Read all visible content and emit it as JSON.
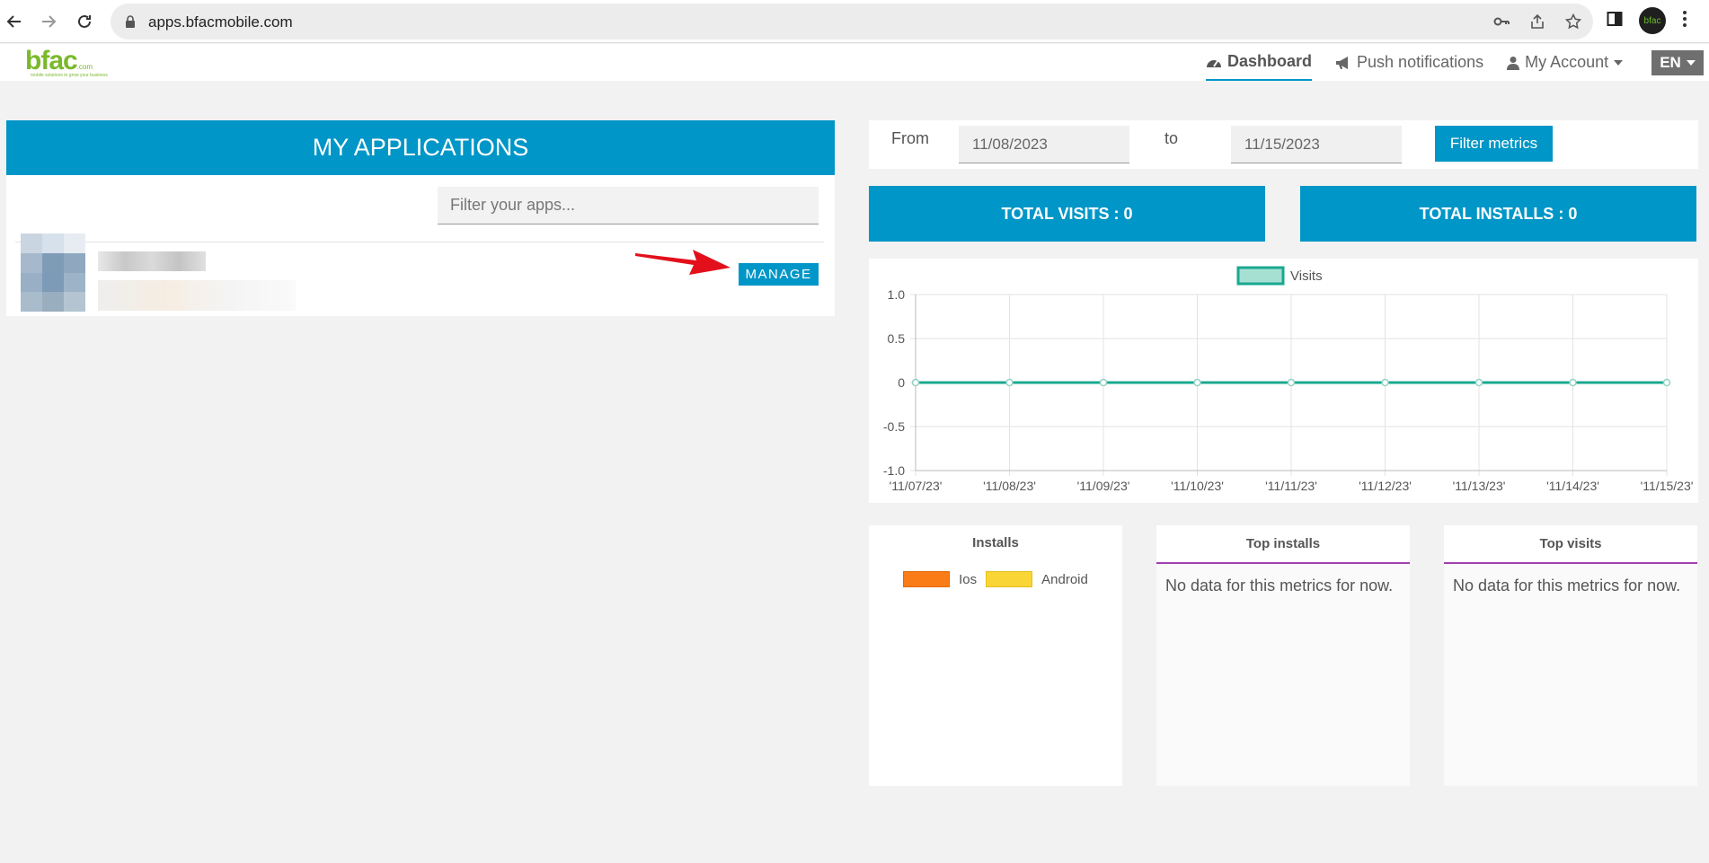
{
  "browser": {
    "url": "apps.bfacmobile.com",
    "profile_text": "bfac"
  },
  "header": {
    "logo_word": "bfac",
    "logo_domain": ".com",
    "logo_tagline": "mobile solutions to grow your business",
    "nav": [
      {
        "label": "Dashboard",
        "active": true
      },
      {
        "label": "Push notifications",
        "active": false
      },
      {
        "label": "My Account",
        "active": false
      }
    ],
    "language": "EN"
  },
  "apps_panel": {
    "title": "MY APPLICATIONS",
    "filter_placeholder": "Filter your apps...",
    "manage_label": "MANAGE"
  },
  "filters": {
    "from_label": "From",
    "from_value": "11/08/2023",
    "to_label": "to",
    "to_value": "11/15/2023",
    "button_label": "Filter metrics"
  },
  "stats": {
    "visits_label": "TOTAL VISITS : 0",
    "installs_label": "TOTAL INSTALLS : 0"
  },
  "chart_data": {
    "type": "line",
    "series": [
      {
        "name": "Visits",
        "color": "#1aa88f",
        "fill": "#a6e0d3",
        "values": [
          0,
          0,
          0,
          0,
          0,
          0,
          0,
          0,
          0
        ]
      }
    ],
    "categories": [
      "'11/07/23'",
      "'11/08/23'",
      "'11/09/23'",
      "'11/10/23'",
      "'11/11/23'",
      "'11/12/23'",
      "'11/13/23'",
      "'11/14/23'",
      "'11/15/23'"
    ],
    "yticks": [
      "1.0",
      "0.5",
      "0",
      "-0.5",
      "-1.0"
    ],
    "ylim": [
      -1,
      1
    ],
    "grid": true,
    "legend_position": "top-center"
  },
  "cards": {
    "installs": {
      "title": "Installs",
      "legend": [
        {
          "label": "Ios",
          "color": "#f97c16"
        },
        {
          "label": "Android",
          "color": "#f9d535"
        }
      ]
    },
    "top_installs": {
      "title": "Top installs",
      "empty": "No data for this metrics for now."
    },
    "top_visits": {
      "title": "Top visits",
      "empty": "No data for this metrics for now."
    }
  },
  "colors": {
    "accent": "#0096c7",
    "brand_green": "#7ab929",
    "card_rule": "#a23fb2"
  }
}
